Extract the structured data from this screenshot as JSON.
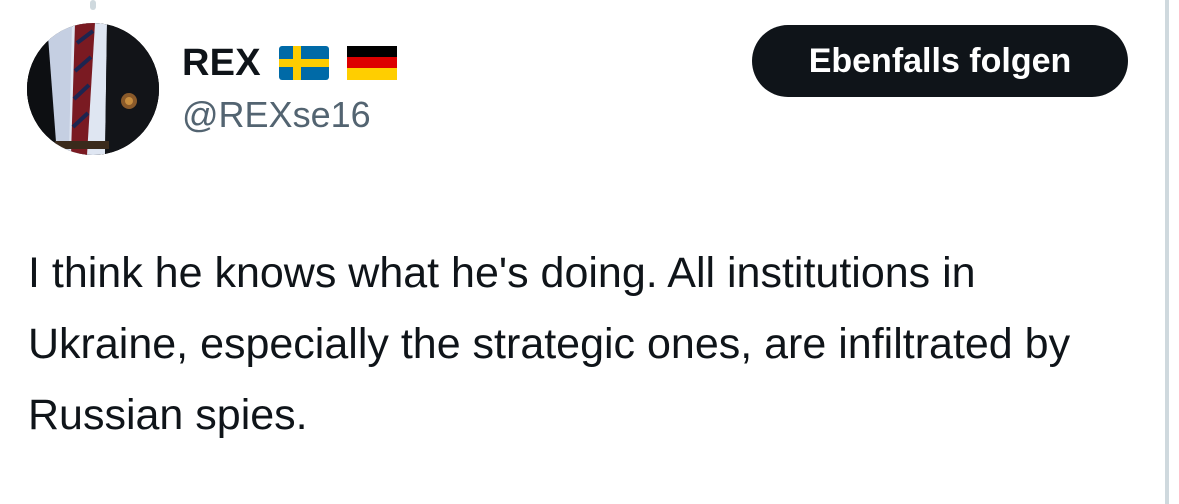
{
  "tweet": {
    "author": {
      "display_name": "REX",
      "handle": "@REXse16",
      "avatar_icon": "avatar-icon",
      "flags": [
        {
          "icon": "sweden-flag-icon",
          "colors": [
            "#006aa7",
            "#fecc00"
          ]
        },
        {
          "icon": "germany-flag-icon",
          "colors": [
            "#000000",
            "#dd0000",
            "#ffce00"
          ]
        }
      ]
    },
    "follow_button": {
      "label": "Ebenfalls folgen",
      "background": "#0f1419",
      "text_color": "#ffffff"
    },
    "text": "I think he knows what he's doing. All institutions in Ukraine, especially the strategic ones, are infiltrated by Russian spies."
  },
  "colors": {
    "text_primary": "#0f1419",
    "text_secondary": "#536471",
    "border": "#cfd9de"
  }
}
